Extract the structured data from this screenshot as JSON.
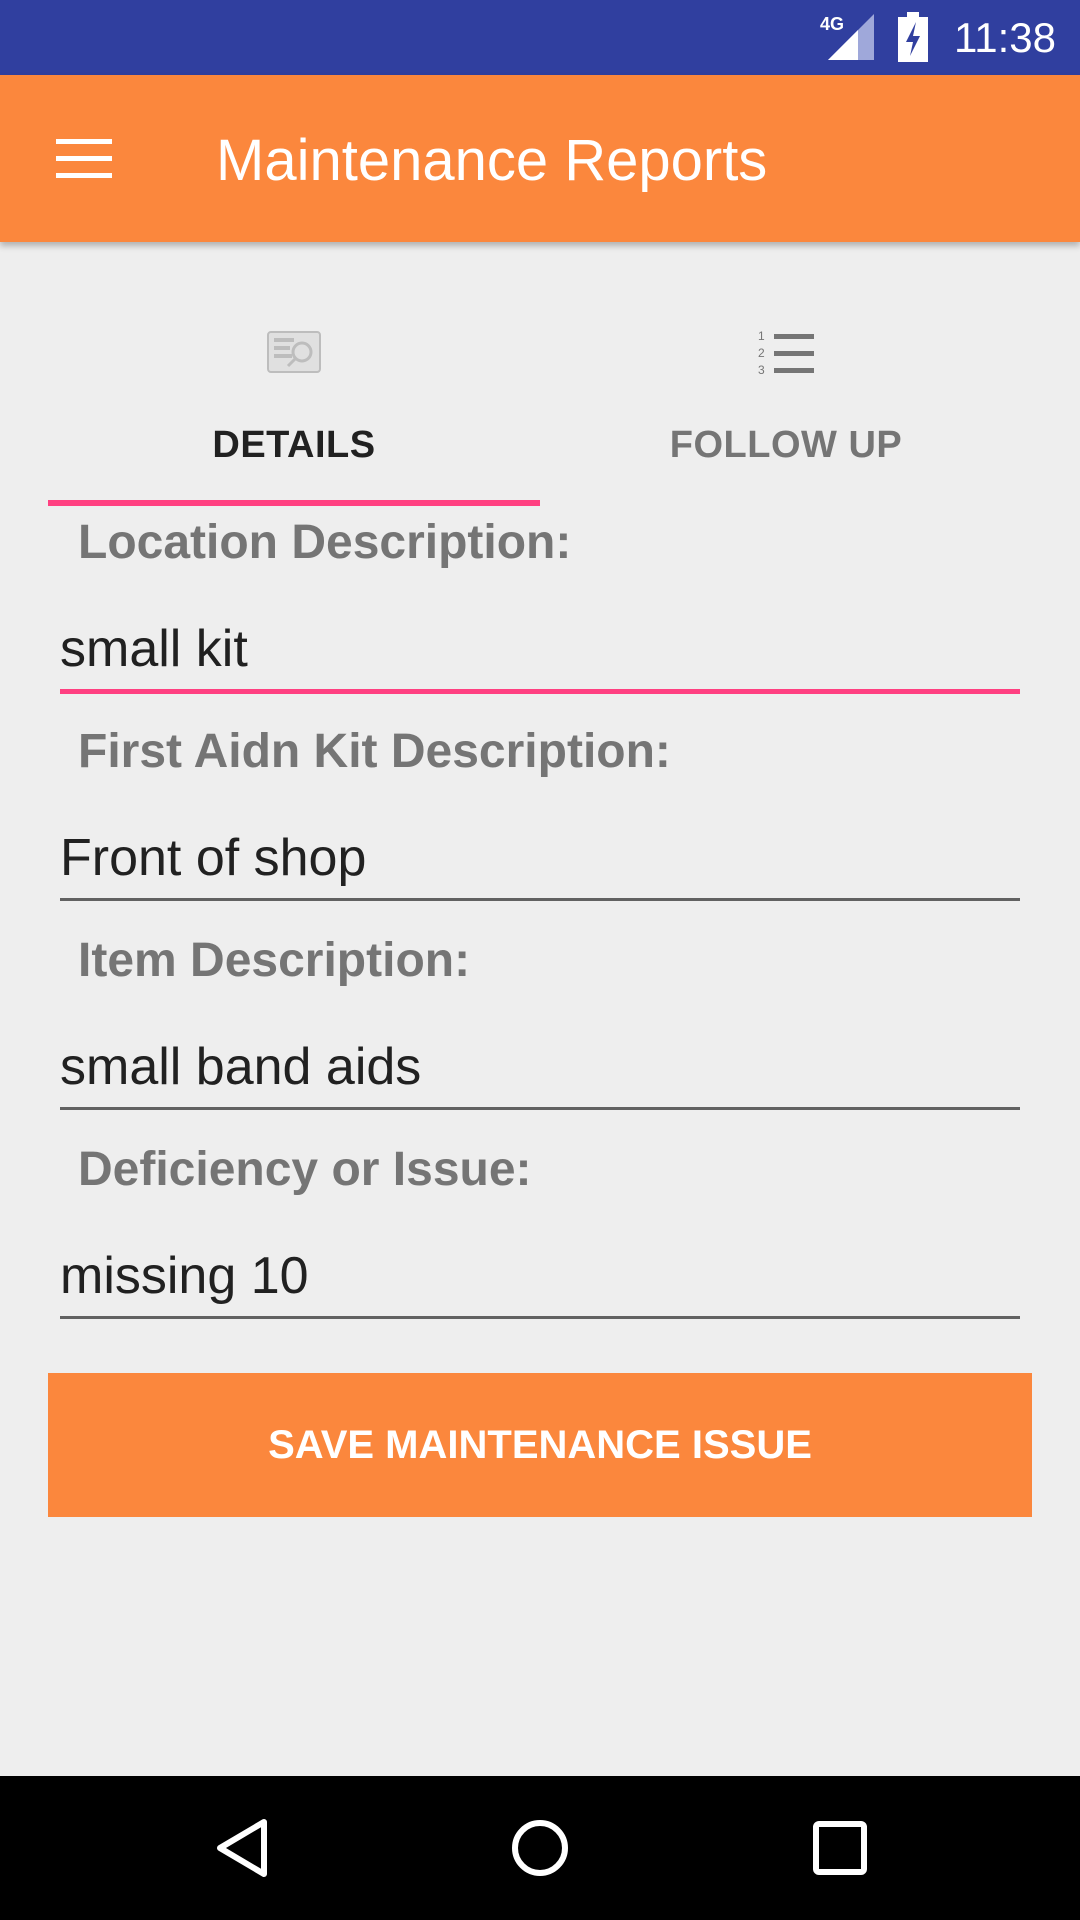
{
  "status_bar": {
    "time": "11:38",
    "network": "4G",
    "icons": [
      "signal-icon",
      "battery-charging-icon"
    ]
  },
  "app_bar": {
    "title": "Maintenance Reports",
    "menu_icon": "hamburger-menu-icon"
  },
  "tabs": [
    {
      "label": "DETAILS",
      "icon": "report-search-icon",
      "selected": true
    },
    {
      "label": "FOLLOW UP",
      "icon": "numbered-list-icon",
      "selected": false
    }
  ],
  "form": {
    "fields": [
      {
        "label": "Location Description:",
        "value": "small kit"
      },
      {
        "label": "First Aidn Kit Description:",
        "value": "Front of shop"
      },
      {
        "label": "Item Description:",
        "value": "small band aids"
      },
      {
        "label": "Deficiency or Issue:",
        "value": "missing 10"
      }
    ],
    "save_label": "SAVE MAINTENANCE ISSUE"
  },
  "nav_bar": {
    "icons": [
      "back-icon",
      "home-icon",
      "recents-icon"
    ]
  },
  "colors": {
    "status_bar": "#303f9f",
    "accent_orange": "#fb873d",
    "indicator_pink": "#ff4081"
  }
}
